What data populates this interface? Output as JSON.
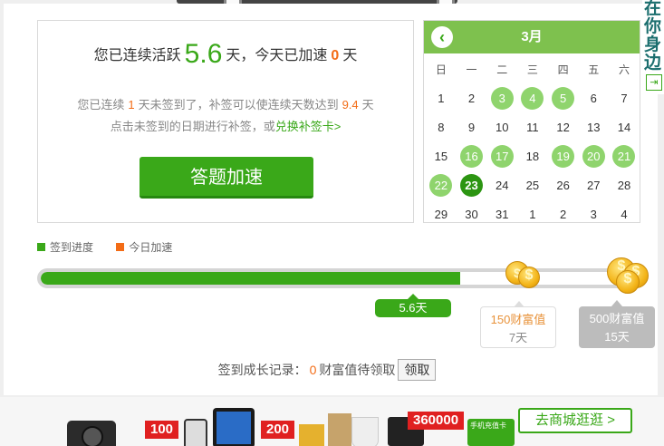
{
  "summary": {
    "prefix": "您已连续活跃",
    "days": "5.6",
    "mid": "天，今天已加速",
    "today_speed": "0",
    "suffix": "天"
  },
  "resign": {
    "l1_a": "您已连续",
    "unsigned_days": "1",
    "l1_b": "天未签到了，补签可以使连续天数达到",
    "target_days": "9.4",
    "l1_c": "天",
    "l2_a": "点击未签到的日期进行补签，或",
    "l2_link": "兑换补签卡>"
  },
  "speed_button": "答题加速",
  "calendar": {
    "month": "3月",
    "back_icon": "chevron-left-icon",
    "weekdays": [
      "日",
      "一",
      "二",
      "三",
      "四",
      "五",
      "六"
    ],
    "weeks": [
      [
        {
          "d": "1",
          "s": ""
        },
        {
          "d": "2",
          "s": ""
        },
        {
          "d": "3",
          "s": "signed"
        },
        {
          "d": "4",
          "s": "signed"
        },
        {
          "d": "5",
          "s": "signed"
        },
        {
          "d": "6",
          "s": ""
        },
        {
          "d": "7",
          "s": ""
        }
      ],
      [
        {
          "d": "8",
          "s": ""
        },
        {
          "d": "9",
          "s": ""
        },
        {
          "d": "10",
          "s": ""
        },
        {
          "d": "11",
          "s": ""
        },
        {
          "d": "12",
          "s": ""
        },
        {
          "d": "13",
          "s": ""
        },
        {
          "d": "14",
          "s": ""
        }
      ],
      [
        {
          "d": "15",
          "s": ""
        },
        {
          "d": "16",
          "s": "signed"
        },
        {
          "d": "17",
          "s": "signed"
        },
        {
          "d": "18",
          "s": ""
        },
        {
          "d": "19",
          "s": "signed"
        },
        {
          "d": "20",
          "s": "signed"
        },
        {
          "d": "21",
          "s": "signed"
        }
      ],
      [
        {
          "d": "22",
          "s": "signed"
        },
        {
          "d": "23",
          "s": "today"
        },
        {
          "d": "24",
          "s": ""
        },
        {
          "d": "25",
          "s": ""
        },
        {
          "d": "26",
          "s": ""
        },
        {
          "d": "27",
          "s": ""
        },
        {
          "d": "28",
          "s": ""
        }
      ],
      [
        {
          "d": "29",
          "s": ""
        },
        {
          "d": "30",
          "s": ""
        },
        {
          "d": "31",
          "s": ""
        },
        {
          "d": "1",
          "s": "muted"
        },
        {
          "d": "2",
          "s": "muted"
        },
        {
          "d": "3",
          "s": "muted"
        },
        {
          "d": "4",
          "s": "muted"
        }
      ]
    ]
  },
  "sidebar": {
    "chars": [
      "在",
      "你",
      "身",
      "边"
    ],
    "exit_icon": "exit-icon"
  },
  "legend": {
    "progress_label": "签到进度",
    "progress_color": "#3aa819",
    "today_label": "今日加速",
    "today_color": "#f36c16"
  },
  "progress": {
    "fraction": 0.7,
    "current_label": "5.6天"
  },
  "rewards": [
    {
      "value": "150财富值",
      "days": "7天"
    },
    {
      "value": "500财富值",
      "days": "15天"
    }
  ],
  "record": {
    "prefix": "签到成长记录：",
    "amount": "0",
    "suffix": "财富值待领取",
    "claim": "领取"
  },
  "footer": {
    "tag_100": "100",
    "tag_200": "200",
    "tag_360000": "360000",
    "card_label": "手机充值卡",
    "shop_button": "去商城逛逛 >"
  }
}
